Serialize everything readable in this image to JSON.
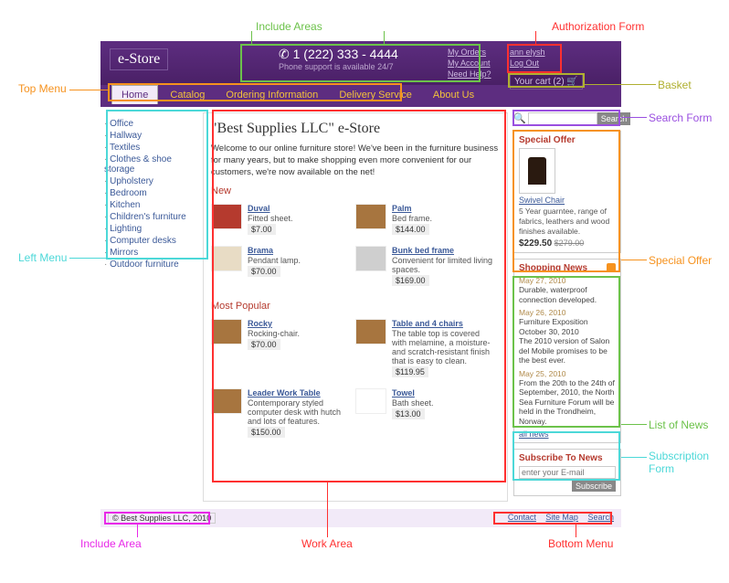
{
  "header": {
    "logo": "e-Store",
    "phone": "1 (222) 333 - 4444",
    "phone_sub": "Phone support is available 24/7",
    "links1": [
      "My Orders",
      "My Account",
      "Need Help?"
    ],
    "links2": [
      "ann elysh",
      "Log Out"
    ],
    "cart": "Your cart (2) 🛒"
  },
  "topmenu": [
    "Home",
    "Catalog",
    "Ordering Information",
    "Delivery Service",
    "About Us"
  ],
  "leftmenu": [
    "Office",
    "Hallway",
    "Textiles",
    "Clothes & shoe storage",
    "Upholstery",
    "Bedroom",
    "Kitchen",
    "Children's furniture",
    "Lighting",
    "Computer desks",
    "Mirrors",
    "Outdoor furniture"
  ],
  "work": {
    "title": "\"Best Supplies LLC\" e-Store",
    "intro": "Welcome to our online furniture store! We've been in the furniture business for many years, but to make shopping even more convenient for our customers, we're now available on the net!",
    "new_title": "New",
    "popular_title": "Most Popular",
    "new": [
      {
        "name": "Duval",
        "desc": "Fitted sheet.",
        "price": "$7.00"
      },
      {
        "name": "Palm",
        "desc": "Bed frame.",
        "price": "$144.00"
      },
      {
        "name": "Brama",
        "desc": "Pendant lamp.",
        "price": "$70.00"
      },
      {
        "name": "Bunk bed frame",
        "desc": "Convenient for limited living spaces.",
        "price": "$169.00"
      }
    ],
    "popular": [
      {
        "name": "Rocky",
        "desc": "Rocking-chair.",
        "price": "$70.00"
      },
      {
        "name": "Table and 4 chairs",
        "desc": "The table top is covered with melamine, a moisture- and scratch-resistant finish that is easy to clean.",
        "price": "$119.95"
      },
      {
        "name": "Leader Work Table",
        "desc": "Contemporary styled computer desk with hutch and lots of features.",
        "price": "$150.00"
      },
      {
        "name": "Towel",
        "desc": "Bath sheet.",
        "price": "$13.00"
      }
    ]
  },
  "search": {
    "placeholder": "",
    "btn": "Search",
    "icon": "🔍"
  },
  "offer": {
    "title": "Special Offer",
    "name": "Swivel Chair",
    "desc": "5 Year guarntee, range of fabrics, leathers and wood finishes available.",
    "price": "$229.50",
    "old": "$279.00"
  },
  "news": {
    "title": "Shopping News",
    "items": [
      {
        "date": "May 27, 2010",
        "body": "Durable, waterproof connection developed."
      },
      {
        "date": "May 26, 2010",
        "body": "Furniture Exposition October 30, 2010\nThe 2010 version of Salon del Mobile promises to be the best ever."
      },
      {
        "date": "May 25, 2010",
        "body": "From the 20th to the 24th of September, 2010, the North Sea Furniture Forum will be held in the Trondheim, Norway."
      }
    ],
    "all": "all news"
  },
  "subscribe": {
    "title": "Subscribe To News",
    "placeholder": "enter your E-mail",
    "btn": "Subscribe"
  },
  "footer": {
    "copy": "© Best Supplies LLC, 2010",
    "links": [
      "Contact",
      "Site Map",
      "Search"
    ]
  },
  "callouts": {
    "include_areas": "Include Areas",
    "auth_form": "Authorization Form",
    "top_menu": "Top Menu",
    "basket": "Basket",
    "search_form": "Search Form",
    "left_menu": "Left Menu",
    "special_offer": "Special Offer",
    "list_news": "List of News",
    "subscription": "Subscription Form",
    "include_area": "Include Area",
    "work_area": "Work Area",
    "bottom_menu": "Bottom Menu"
  }
}
